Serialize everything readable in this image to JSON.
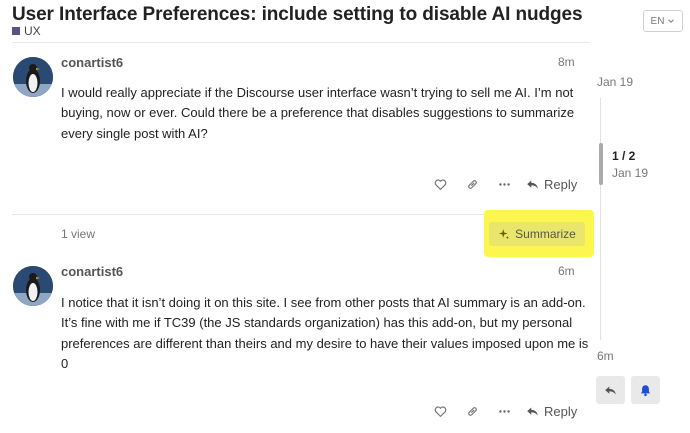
{
  "topic": {
    "title": "User Interface Preferences: include setting to disable AI nudges",
    "category": "UX",
    "category_color": "#5a4e8c"
  },
  "language_button": {
    "label": "EN"
  },
  "posts": [
    {
      "username": "conartist6",
      "age": "8m",
      "body": "I would really appreciate if the Discourse user interface wasn’t trying to sell me AI. I’m not buying, now or ever. Could there be a preference that disables suggestions to summarize every single post with AI?",
      "actions": {
        "like_icon": "heart-icon",
        "link_icon": "link-icon",
        "more_icon": "ellipsis-icon",
        "reply_label": "Reply"
      }
    },
    {
      "username": "conartist6",
      "age": "6m",
      "body": "I notice that it isn’t doing it on this site. I see from other posts that AI summary is an add-on. It’s fine with me if TC39 (the JS standards organization) has this add-on, but my personal preferences are different than theirs and my desire to have their values imposed upon me is 0",
      "actions": {
        "like_icon": "heart-icon",
        "link_icon": "link-icon",
        "more_icon": "ellipsis-icon",
        "reply_label": "Reply"
      }
    }
  ],
  "topic_map": {
    "views": "1 view",
    "summarize_label": "Summarize",
    "highlight_color": "#fdf64f"
  },
  "timeline": {
    "start_date": "Jan 19",
    "position": "1 / 2",
    "current_date": "Jan 19",
    "end_date": "6m"
  },
  "side_buttons": {
    "reply_icon": "reply-icon",
    "notification_icon": "bell-icon"
  }
}
